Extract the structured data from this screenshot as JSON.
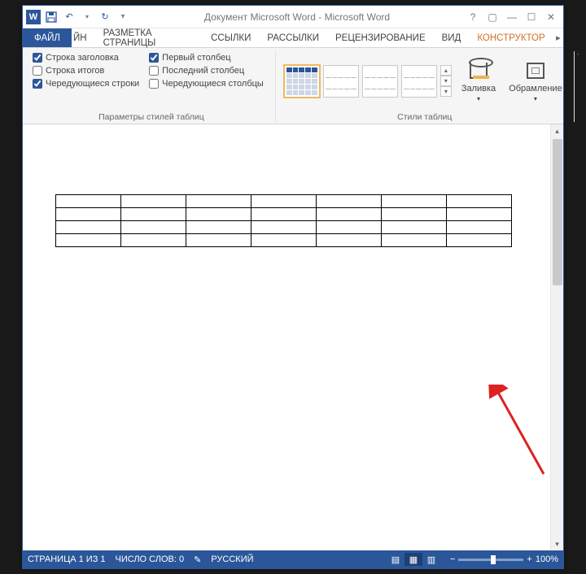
{
  "titlebar": {
    "title": "Документ Microsoft Word - Microsoft Word"
  },
  "tabs": {
    "file": "ФАЙЛ",
    "partial": "ЙН",
    "layout": "РАЗМЕТКА СТРАНИЦЫ",
    "references": "ССЫЛКИ",
    "mailings": "РАССЫЛКИ",
    "review": "РЕЦЕНЗИРОВАНИЕ",
    "view": "ВИД",
    "design": "КОНСТРУКТОР"
  },
  "ribbon": {
    "options_group": {
      "header_row": "Строка заголовка",
      "total_row": "Строка итогов",
      "banded_rows": "Чередующиеся строки",
      "first_column": "Первый столбец",
      "last_column": "Последний столбец",
      "banded_columns": "Чередующиеся столбцы",
      "label": "Параметры стилей таблиц"
    },
    "styles_group": {
      "shading": "Заливка",
      "borders": "Обрамление",
      "label": "Стили таблиц"
    }
  },
  "statusbar": {
    "page": "СТРАНИЦА 1 ИЗ 1",
    "words": "ЧИСЛО СЛОВ: 0",
    "lang": "РУССКИЙ",
    "zoom": "100%",
    "minus": "−",
    "plus": "+"
  },
  "table": {
    "rows": 4,
    "cols": 7
  }
}
